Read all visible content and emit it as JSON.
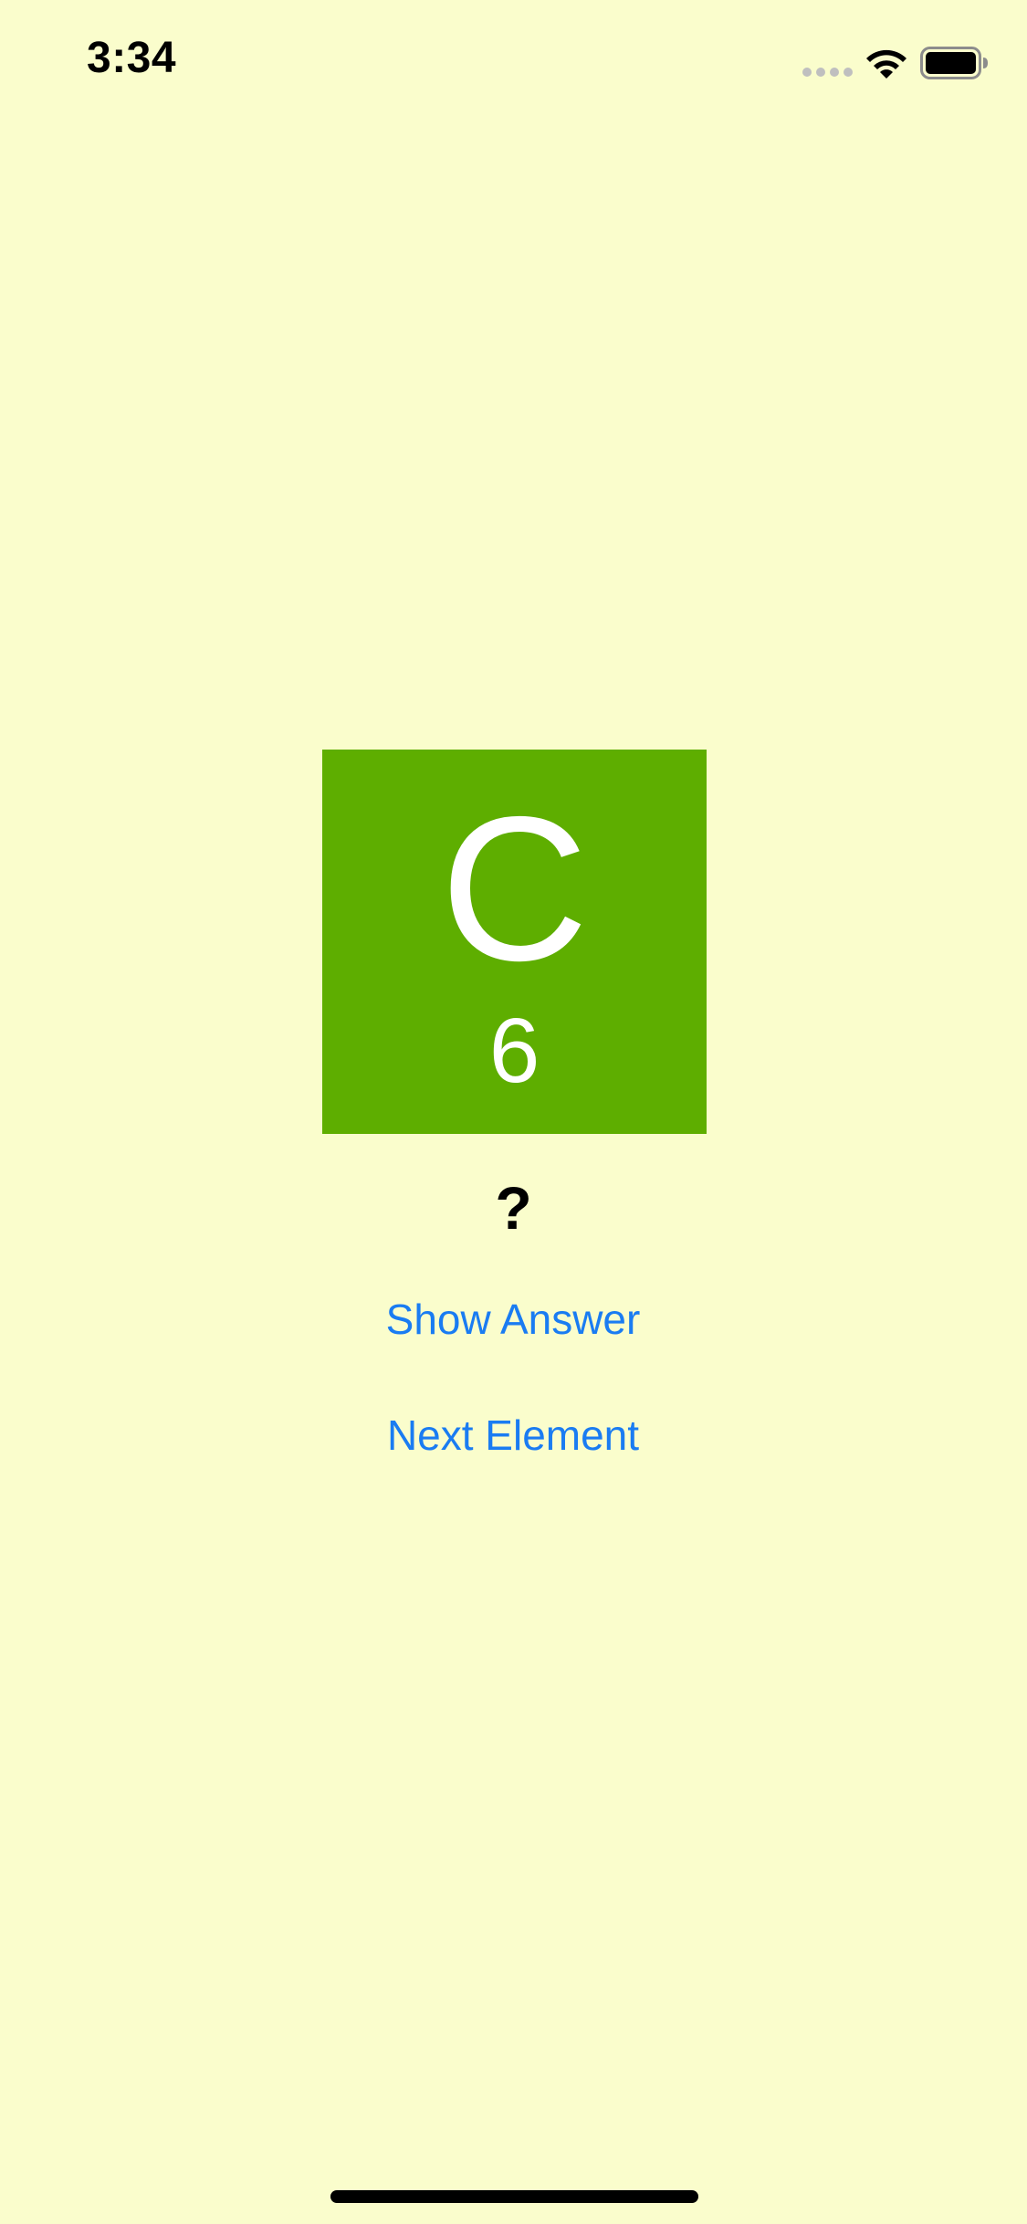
{
  "status_bar": {
    "time": "3:34",
    "icons": [
      "cell-signal-icon",
      "wifi-icon",
      "battery-icon"
    ]
  },
  "element_card": {
    "symbol": "C",
    "atomic_number": "6",
    "tile_color": "#5eae00",
    "text_color": "#ffffff"
  },
  "answer": {
    "text": "?"
  },
  "buttons": {
    "show_answer_label": "Show Answer",
    "next_element_label": "Next Element"
  },
  "colors": {
    "background": "#fafdcc",
    "accent": "#1a7cf2"
  }
}
